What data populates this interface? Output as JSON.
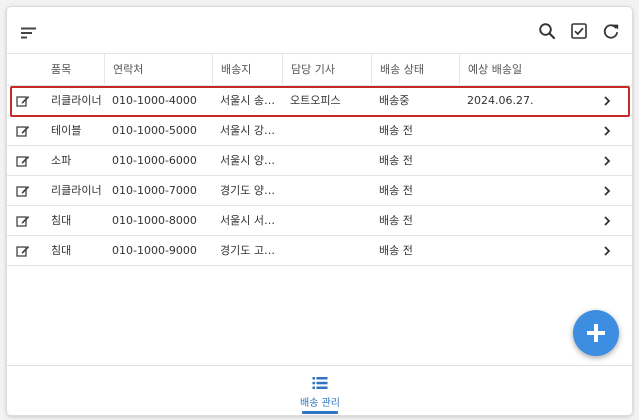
{
  "toolbar": {
    "menu_icon": "sort-lines-icon",
    "search_icon": "search-icon",
    "checkbox_icon": "checkbox-checked-icon",
    "refresh_icon": "refresh-icon"
  },
  "table": {
    "columns": [
      "품목",
      "연락처",
      "배송지",
      "담당 기사",
      "배송 상태",
      "예상 배송일"
    ],
    "rows": [
      {
        "item": "리클라이너",
        "phone": "010-1000-4000",
        "address": "서울시 송파구",
        "driver": "오트오피스",
        "status": "배송중",
        "date": "2024.06.27."
      },
      {
        "item": "테이블",
        "phone": "010-1000-5000",
        "address": "서울시 강서구",
        "driver": "",
        "status": "배송 전",
        "date": ""
      },
      {
        "item": "소파",
        "phone": "010-1000-6000",
        "address": "서울시 양천구",
        "driver": "",
        "status": "배송 전",
        "date": ""
      },
      {
        "item": "리클라이너",
        "phone": "010-1000-7000",
        "address": "경기도 양평군",
        "driver": "",
        "status": "배송 전",
        "date": ""
      },
      {
        "item": "침대",
        "phone": "010-1000-8000",
        "address": "서울시 서초구",
        "driver": "",
        "status": "배송 전",
        "date": ""
      },
      {
        "item": "침대",
        "phone": "010-1000-9000",
        "address": "경기도 고양시",
        "driver": "",
        "status": "배송 전",
        "date": ""
      }
    ]
  },
  "fab": {
    "icon": "plus-icon"
  },
  "bottom_nav": {
    "label": "배송 관리",
    "icon": "list-icon"
  },
  "colors": {
    "accent": "#3d8ee0",
    "nav_active": "#2f74c0",
    "highlight": "#c62828"
  }
}
